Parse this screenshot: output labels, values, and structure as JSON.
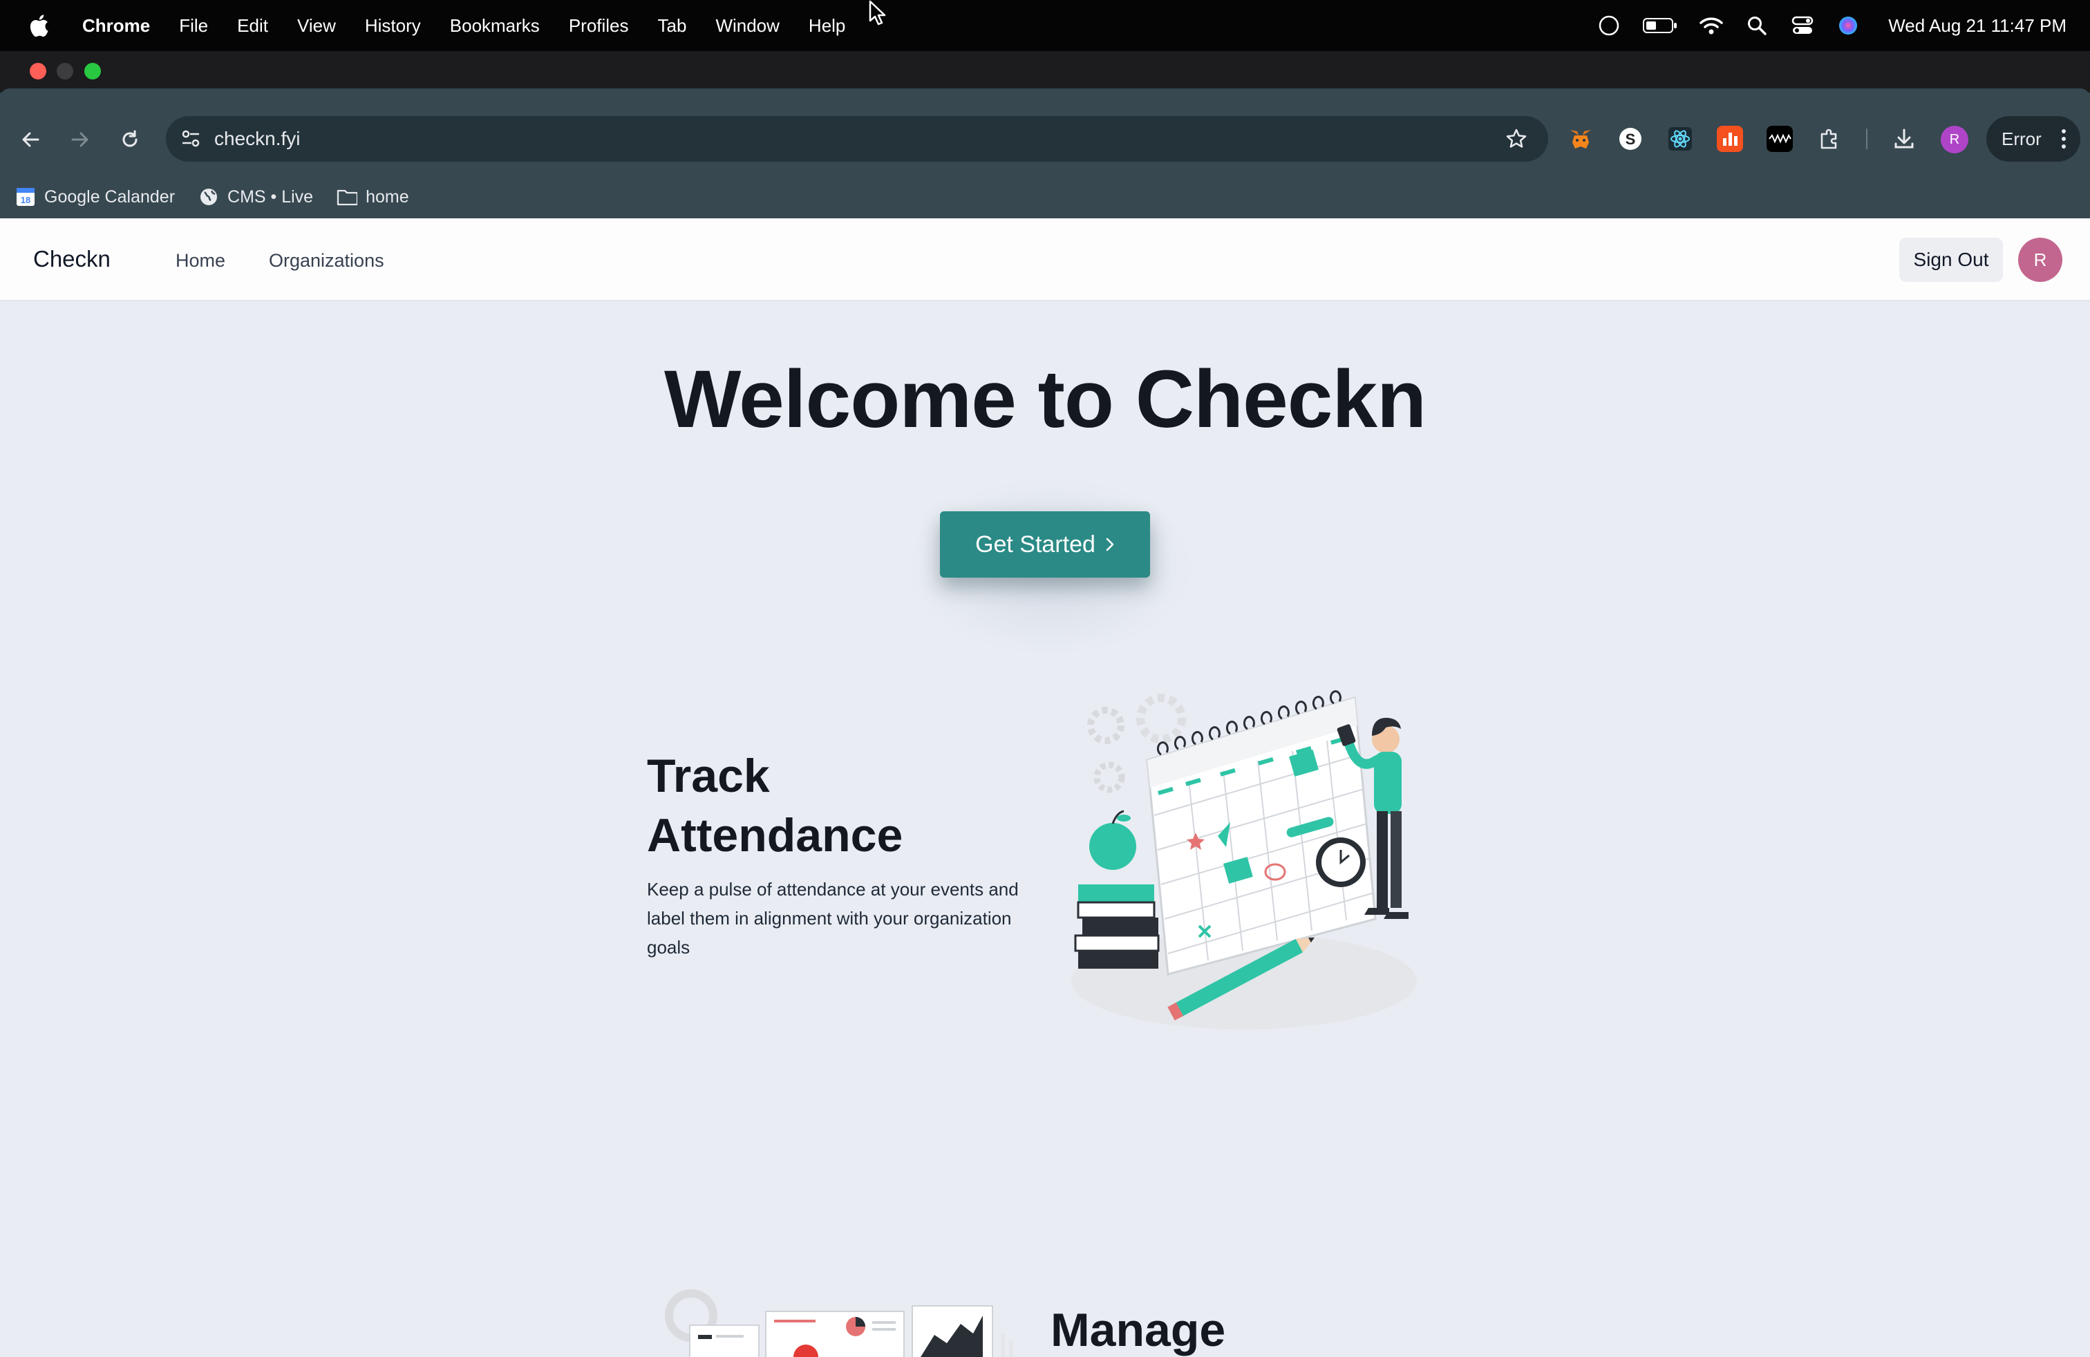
{
  "menubar": {
    "app_name": "Chrome",
    "items": [
      "File",
      "Edit",
      "View",
      "History",
      "Bookmarks",
      "Profiles",
      "Tab",
      "Window",
      "Help"
    ],
    "datetime": "Wed Aug 21  11:47 PM",
    "status_icons": [
      "focus-icon",
      "battery-icon",
      "wifi-icon",
      "spotlight-icon",
      "control-center-icon",
      "siri-icon"
    ]
  },
  "browser": {
    "url": "checkn.fyi",
    "profile_initial": "R",
    "error_label": "Error",
    "extensions": [
      "metamask-icon",
      "s-extension-icon",
      "react-devtools-icon",
      "orange-chart-extension-icon",
      "waveform-extension-icon",
      "extensions-puzzle-icon"
    ],
    "bookmarks": [
      {
        "label": "Google Calander",
        "icon": "calendar-icon"
      },
      {
        "label": "CMS • Live",
        "icon": "globe-icon"
      },
      {
        "label": "home",
        "icon": "folder-icon"
      }
    ]
  },
  "site": {
    "brand": "Checkn",
    "nav": [
      "Home",
      "Organizations"
    ],
    "sign_out": "Sign Out",
    "avatar_initial": "R",
    "hero_title": "Welcome to Checkn",
    "cta_label": "Get Started",
    "feature": {
      "title_line1": "Track",
      "title_line2": "Attendance",
      "description": "Keep a pulse of attendance at your events and label them in alignment with your organization goals"
    },
    "next_section_title": "Manage"
  },
  "colors": {
    "brand_teal": "#2b8a86",
    "illustration_teal": "#2fc4a6",
    "avatar_pink": "#c2668f",
    "page_bg": "#e9edf3",
    "browser_chrome": "#374850"
  }
}
